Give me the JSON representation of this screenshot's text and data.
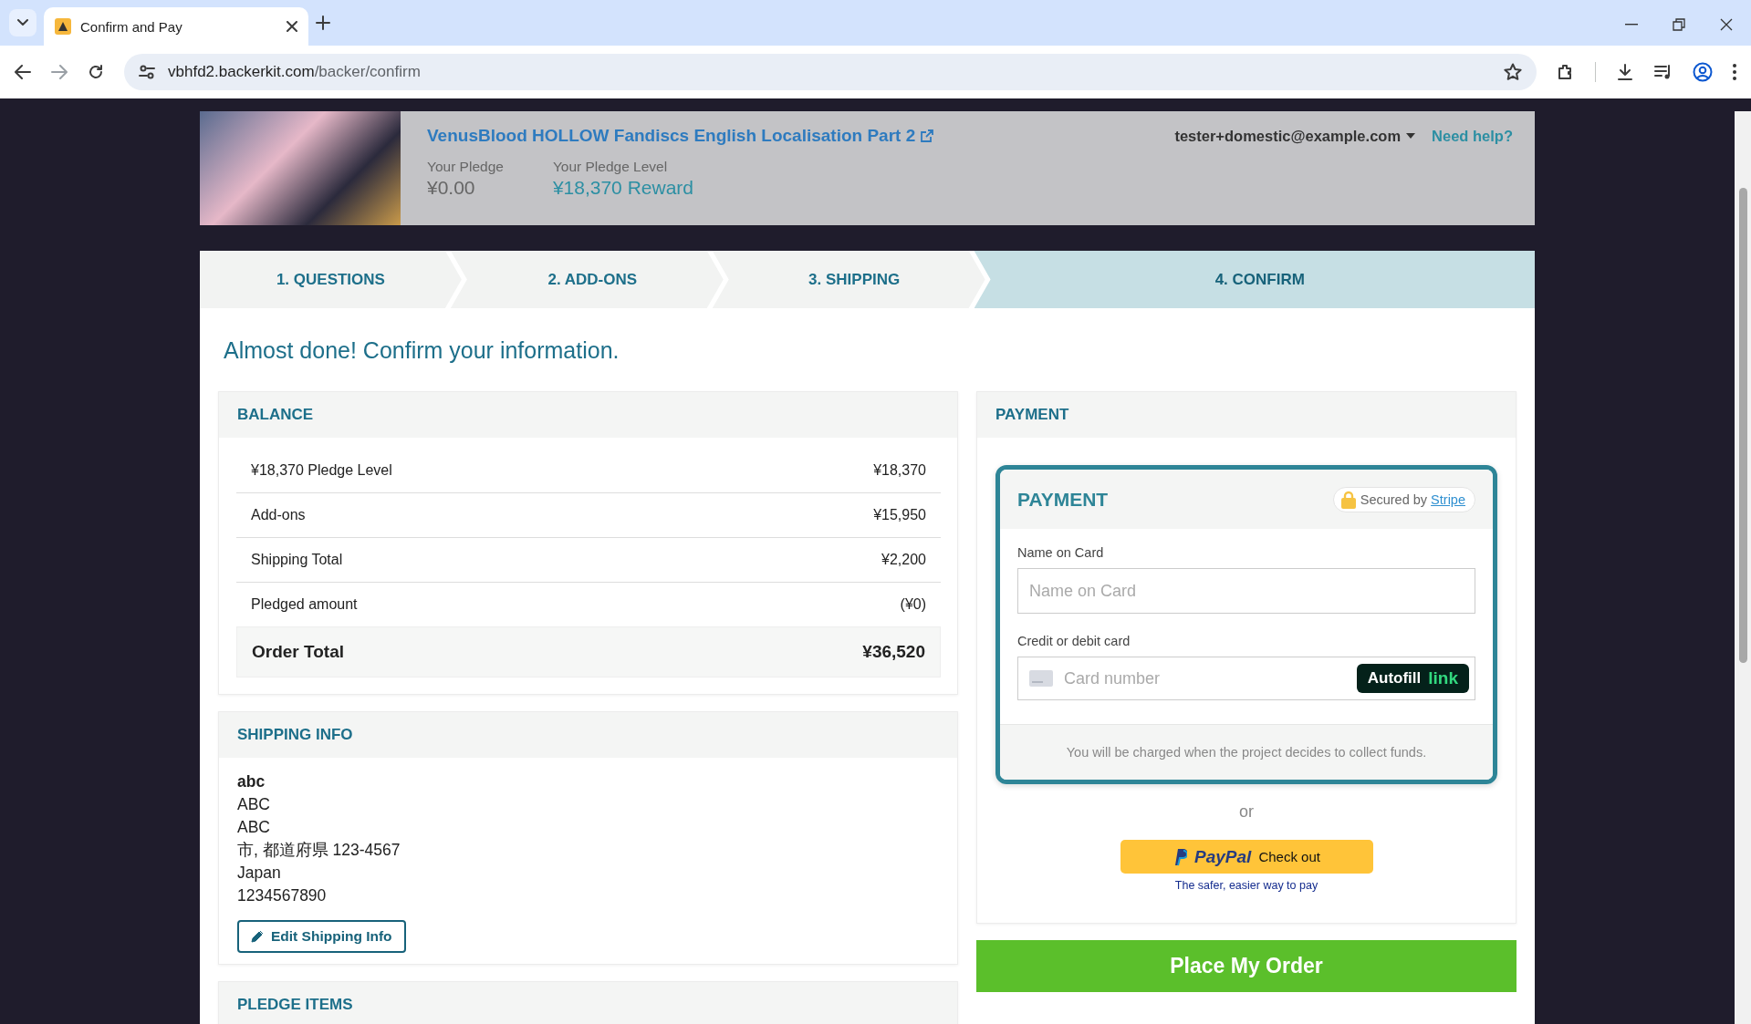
{
  "browser": {
    "tab_title": "Confirm and Pay",
    "url_host": "vbhfd2.backerkit.com",
    "url_path": "/backer/confirm"
  },
  "header": {
    "project_title": "VenusBlood HOLLOW Fandiscs English Localisation Part 2",
    "account_email": "tester+domestic@example.com",
    "help_link": "Need help?",
    "pledge_label": "Your Pledge",
    "pledge_value": "¥0.00",
    "level_label": "Your Pledge Level",
    "level_value": "¥18,370 Reward"
  },
  "steps": [
    {
      "label": "1. QUESTIONS",
      "selected": false
    },
    {
      "label": "2. ADD-ONS",
      "selected": false
    },
    {
      "label": "3. SHIPPING",
      "selected": false
    },
    {
      "label": "4. CONFIRM",
      "selected": true
    }
  ],
  "heading": "Almost done! Confirm your information.",
  "balance": {
    "title": "BALANCE",
    "rows": [
      {
        "label": "¥18,370 Pledge Level",
        "amount": "¥18,370"
      },
      {
        "label": "Add-ons",
        "amount": "¥15,950"
      },
      {
        "label": "Shipping Total",
        "amount": "¥2,200"
      },
      {
        "label": "Pledged amount",
        "amount": "(¥0)"
      }
    ],
    "total": {
      "label": "Order Total",
      "amount": "¥36,520"
    }
  },
  "shipping": {
    "title": "SHIPPING INFO",
    "name": "abc",
    "lines": [
      "ABC",
      "ABC",
      "市, 都道府県 123-4567",
      "Japan",
      "1234567890"
    ],
    "edit_button": "Edit Shipping Info"
  },
  "pledge_items_title": "PLEDGE ITEMS",
  "payment": {
    "title": "PAYMENT",
    "inner_title": "PAYMENT",
    "secured_text": "Secured by",
    "secured_link": "Stripe",
    "name_label": "Name on Card",
    "name_placeholder": "Name on Card",
    "card_label": "Credit or debit card",
    "card_placeholder": "Card number",
    "autofill": "Autofill",
    "autofill_brand": "link",
    "note": "You will be charged when the project decides to collect funds.",
    "or": "or",
    "paypal_brand": "PayPal",
    "paypal_action": "Check out",
    "paypal_tagline": "The safer, easier way to pay"
  },
  "place_order": "Place My Order"
}
